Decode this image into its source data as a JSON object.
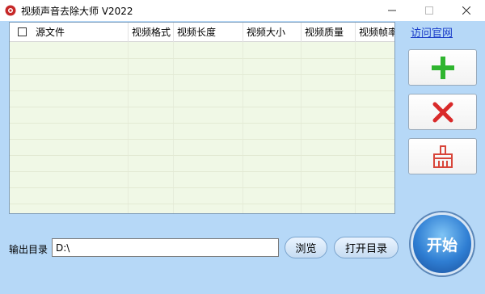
{
  "window": {
    "title": "视频声音去除大师 V2022"
  },
  "titlebar": {
    "minimize_icon": "minimize-icon",
    "maximize_icon": "maximize-icon",
    "close_icon": "close-icon"
  },
  "grid": {
    "columns": [
      "源文件",
      "视频格式",
      "视频长度",
      "视频大小",
      "视频质量",
      "视频帧率"
    ],
    "rows": []
  },
  "sidebar": {
    "link_label": "访问官网",
    "add_icon": "plus-icon",
    "delete_icon": "cross-icon",
    "clear_icon": "broom-icon",
    "add_color": "#2fb52f",
    "delete_color": "#d92a2a",
    "clear_color": "#d8453a"
  },
  "output": {
    "label": "输出目录",
    "value": "D:\\",
    "browse_label": "浏览",
    "open_label": "打开目录"
  },
  "start": {
    "label": "开始"
  },
  "colors": {
    "background": "#b6d8f7",
    "grid_bg": "#f0f8e6",
    "link": "#1a3cc9",
    "start": "#2f7ed3"
  }
}
